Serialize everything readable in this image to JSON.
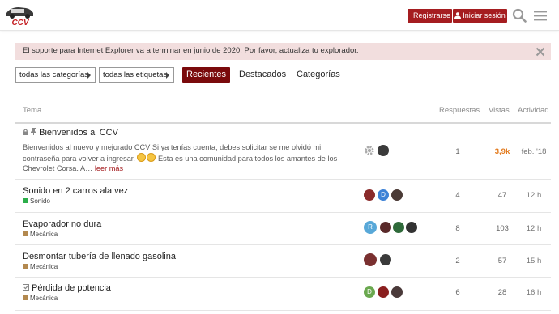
{
  "header": {
    "logo_text": "CCV",
    "register_label": "Registrarse",
    "login_label": "Iniciar sesión"
  },
  "alert": {
    "text": "El soporte para Internet Explorer va a terminar en junio de 2020. Por favor, actualiza tu explorador."
  },
  "nav": {
    "categories_dropdown": "todas las categorías",
    "tags_dropdown": "todas las etiquetas",
    "tabs": [
      "Recientes",
      "Destacados",
      "Categorías"
    ],
    "active_tab": "Recientes"
  },
  "table": {
    "columns": {
      "topic": "Tema",
      "replies": "Respuestas",
      "views": "Vistas",
      "activity": "Actividad"
    },
    "rows": [
      {
        "title": "Bienvenidos al CCV",
        "pinned": true,
        "locked": true,
        "excerpt_part1": "Bienvenidos al nuevo y mejorado CCV Si ya tenías cuenta, debes solicitar se me olvidó mi contraseña para volver a ingresar.",
        "excerpt_part2": "Esta es una comunidad para todos los amantes de los Chevrolet Corsa. A…",
        "read_more": "leer más",
        "replies": "1",
        "views": "3,9k",
        "activity": "feb. '18"
      },
      {
        "title": "Sonido en 2 carros ala vez",
        "category": "Sonido",
        "replies": "4",
        "views": "47",
        "activity": "12 h"
      },
      {
        "title": "Evaporador no dura",
        "category": "Mecánica",
        "replies": "8",
        "views": "103",
        "activity": "12 h"
      },
      {
        "title": "Desmontar tubería de llenado gasolina",
        "category": "Mecánica",
        "replies": "2",
        "views": "57",
        "activity": "15 h"
      },
      {
        "title": "Pérdida de potencia",
        "category": "Mecánica",
        "replies": "6",
        "views": "28",
        "activity": "16 h"
      }
    ],
    "avatar_letters": {
      "row2_second": "D",
      "row3_first": "R",
      "row5_first": "D"
    }
  },
  "colors": {
    "brand_red": "#a51d20",
    "active_tab": "#7a0a0c",
    "alert_bg": "#f2dede",
    "category_sonido": "#2cae4a",
    "category_mecanica": "#b3894f",
    "hot_views": "#e2781a"
  }
}
